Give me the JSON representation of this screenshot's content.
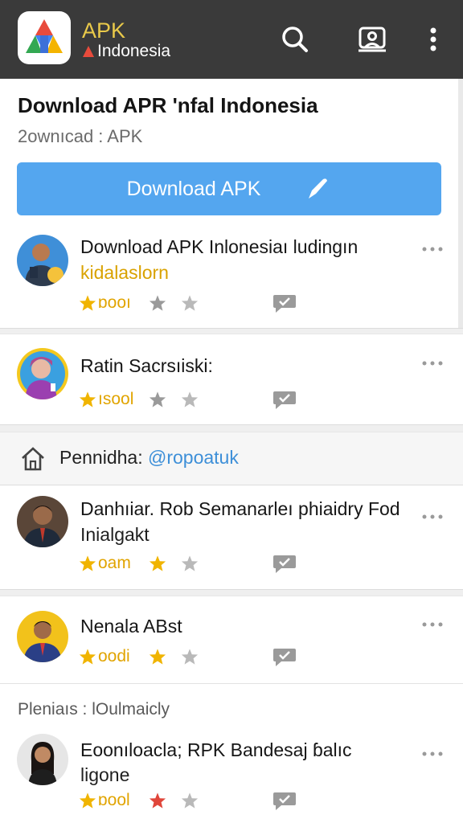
{
  "app_bar": {
    "brand_main": "APK",
    "brand_sub": "Indonesia",
    "icons": [
      "app-logo",
      "search-icon",
      "account-icon",
      "more-vert-icon"
    ]
  },
  "page": {
    "title": "Download APR 'nfal Indonesia",
    "breadcrumb": "2ownıcad  :  APK",
    "download_button": "Download APK"
  },
  "items": [
    {
      "title": "Download APK Inlonesiaı ludingın",
      "subtitle": "kidalaslorn",
      "rating_text": "ɒooı",
      "stars": [
        1,
        0,
        0
      ]
    },
    {
      "title": "Ratin Sacrsıiski:",
      "subtitle": "",
      "rating_text": "ısool",
      "stars": [
        1,
        0,
        0
      ]
    },
    {
      "title": "Danhıiar. Rob Semanarleı phiaidry Fod",
      "subtitle": "Inialgakt",
      "rating_text": "oam",
      "stars": [
        1,
        1,
        0
      ]
    },
    {
      "title": "Nenala ABst",
      "subtitle": "",
      "rating_text": "oodi",
      "stars": [
        1,
        1,
        0
      ]
    },
    {
      "title": "Eoonıloacla; RPK Bandesaj ɓalıc",
      "subtitle": "ligone",
      "rating_text": "ɒool",
      "stars": [
        1,
        1,
        0
      ]
    }
  ],
  "section": {
    "label": "Pennidha:",
    "handle": "@ropoatuk"
  },
  "group": {
    "label": "Pleniaıs  :  lOulmaicly"
  },
  "colors": {
    "app_bar": "#3a3a3a",
    "brand_accent": "#e9c94a",
    "button": "#54a6ef",
    "star_gold": "#f0b400",
    "star_red": "#e0463a",
    "star_grey": "#b9b9b9",
    "link": "#3d8fd8",
    "rating_text": "#e1a400"
  }
}
